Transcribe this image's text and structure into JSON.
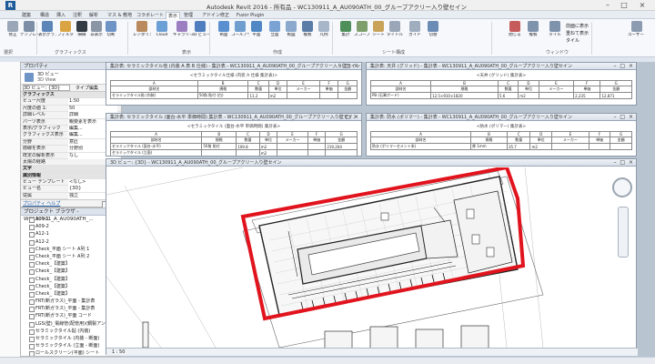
{
  "app": {
    "title": "Autodesk Revit 2016 -  所有品 -  WC130911_A_AU090ATH_00_グループアクリー入り壁セイン",
    "icon_letter": "R"
  },
  "window_controls": {
    "minimize": "–",
    "maximize": "□",
    "close": "×"
  },
  "tabs": [
    {
      "label": "建築",
      "active": false
    },
    {
      "label": "構造",
      "active": false
    },
    {
      "label": "挿入",
      "active": false
    },
    {
      "label": "注釈",
      "active": false
    },
    {
      "label": "解析",
      "active": false
    },
    {
      "label": "マス & 敷地",
      "active": false
    },
    {
      "label": "コラボレート",
      "active": false
    },
    {
      "label": "表示",
      "active": true
    },
    {
      "label": "管理",
      "active": false
    },
    {
      "label": "アドイン",
      "active": false
    },
    {
      "label": "修正",
      "active": false
    },
    {
      "label": "Fuzor Plugin",
      "active": false
    }
  ],
  "ribbon": {
    "buttons": [
      {
        "label": "修正",
        "color": "#9aa7b8"
      },
      {
        "label": "テンプレート",
        "color": "#7c8fa6"
      },
      {
        "label": "表示グラフィックス",
        "color": "#5d86b8"
      },
      {
        "label": "フィルタ",
        "color": "#d9a441"
      },
      {
        "label": "細線",
        "color": "#333b44"
      },
      {
        "label": "非表示",
        "color": "#8a96a5"
      },
      {
        "label": "切断",
        "color": "#6f94c6"
      },
      {
        "label": "レンダリング",
        "color": "#b88a5d"
      },
      {
        "label": "Cloud",
        "color": "#6aa0d6"
      },
      {
        "label": "ギャラリー",
        "color": "#9c7fc1"
      },
      {
        "label": "3D ビュー",
        "color": "#4f7fbf"
      },
      {
        "label": "断面",
        "color": "#5a8fd0"
      },
      {
        "label": "コールアウト",
        "color": "#6f9ecf"
      },
      {
        "label": "平面",
        "color": "#4f88c4"
      },
      {
        "label": "立面",
        "color": "#7aa3d4"
      },
      {
        "label": "製図",
        "color": "#8aa9cc"
      },
      {
        "label": "複製",
        "color": "#5b7ea8"
      },
      {
        "label": "凡例",
        "color": "#a7b6c9"
      },
      {
        "label": "集計",
        "color": "#4f8f5a"
      },
      {
        "label": "スコープ",
        "color": "#7e9f6b"
      },
      {
        "label": "シート",
        "color": "#c9a35a"
      },
      {
        "label": "タイトル",
        "color": "#9aa7b8"
      },
      {
        "label": "ガイド",
        "color": "#a0adbf"
      },
      {
        "label": "切替",
        "color": "#6b8cb5"
      },
      {
        "label": "閉じる",
        "color": "#c65b5b"
      },
      {
        "label": "複製",
        "color": "#7f93ad"
      },
      {
        "label": "タイル",
        "color": "#7f93ad"
      },
      {
        "label": "ユーザー インターフェース",
        "color": "#8c9bb0"
      }
    ],
    "groups": [
      {
        "label": "選択"
      },
      {
        "label": "グラフィックス"
      },
      {
        "label": "表示"
      },
      {
        "label": "作成"
      },
      {
        "label": "シート構成"
      },
      {
        "label": "ウィンドウ"
      }
    ],
    "window_options": [
      "前面に表示",
      "重ねて表示",
      "タイル"
    ]
  },
  "properties": {
    "title": "プロパティ",
    "type_name": "3D ビュー",
    "type_sub": "3D View",
    "selector": "3D ビュー: {3D}",
    "edit_type": "タイプ編集",
    "rows": [
      {
        "k": "グラフィックス",
        "v": "",
        "cat": true
      },
      {
        "k": "ビュー尺度",
        "v": "1:50",
        "cat": false
      },
      {
        "k": "尺度の値 1:",
        "v": "50",
        "cat": false
      },
      {
        "k": "詳細レベル",
        "v": "詳細",
        "cat": false
      },
      {
        "k": "パーツ表示",
        "v": "親要素を表示",
        "cat": false
      },
      {
        "k": "表示/グラフィック",
        "v": "編集...",
        "cat": false
      },
      {
        "k": "グラフィックス表示",
        "v": "編集...",
        "cat": false
      },
      {
        "k": "分野",
        "v": "意匠",
        "cat": false
      },
      {
        "k": "隠線を表示",
        "v": "分野別",
        "cat": false
      },
      {
        "k": "既定の解析表示",
        "v": "なし",
        "cat": false
      },
      {
        "k": "太陽の経路",
        "v": "",
        "cat": false
      },
      {
        "k": "文字",
        "v": "",
        "cat": true
      },
      {
        "k": "識別情報",
        "v": "",
        "cat": true
      },
      {
        "k": "ビュー テンプレート",
        "v": "<なし>",
        "cat": false
      },
      {
        "k": "ビュー名",
        "v": "{3D}",
        "cat": false
      },
      {
        "k": "従属",
        "v": "独立",
        "cat": false
      }
    ],
    "help": "プロパティ ヘルプ",
    "apply": "適用"
  },
  "browser": {
    "title": "プロジェクト ブラウザ - WC130911_A_AU090ATH_...",
    "items": [
      "A09-1",
      "A09-2",
      "A12-1",
      "A12-2",
      "Check_平面 シート   A列 1",
      "Check_平面 シート   A列 2",
      "Check_【建築】",
      "Check_【建築】",
      "Check_【建築】",
      "Check_【建築】",
      "Check_【建築】",
      "FRT(断ガラス)_平面 - 集計表",
      "FRT(断ガラス)_平面 - 集計表",
      "FRT(断ガラス)_平面   コード",
      "LGS(壁)_電線管(配管用)(鋼製アンカ)",
      "セラミックタイル貼 (内装)",
      "セラミックタイル (内装 - 断面)",
      "セラミックタイル (立面 - 断面)",
      "ロールスクリーン(平面)   シート",
      "集計表 - 平面   シート",
      "集計表 - 断面 (床)"
    ]
  },
  "schedules": [
    {
      "title": "集計表: セラミックタイル他 (内装 A 表 B 仕様) - 集計表 - WC130911_A_AU090ATH_00_グループアクリー入り壁セイン",
      "heading": "<セラミックタイル仕様 (内装 A 仕様 集計表)>",
      "head": [
        "A",
        "B",
        "C",
        "D",
        "E",
        "F",
        "G"
      ],
      "sub": [
        "部材名",
        "規格",
        "数量",
        "単位",
        "メーカー",
        "単価",
        "金額"
      ],
      "rows": [
        [
          "セラミックタイル貼 (内装)",
          "50角 貼付 (白)",
          "11.2",
          "m2",
          "",
          "",
          ""
        ]
      ]
    },
    {
      "title": "集計表: 天井 (グリッド) - 集計表 - WC130911_A_AU090ATH_00_グループアクリー入り壁セイン",
      "heading": "<天井 (グリッド) 集計表>",
      "head": [
        "A",
        "B",
        "C",
        "D",
        "E",
        "F",
        "G"
      ],
      "sub": [
        "部材名",
        "規格",
        "数量",
        "単位",
        "メーカー",
        "単価",
        "金額"
      ],
      "rows": [
        [
          "PB (石膏ボード)",
          "12.5×910×1820",
          "5.6",
          "m2",
          "",
          "2,235",
          "12,871"
        ]
      ]
    },
    {
      "title": "集計表: セラミックタイル (面台-水平 単価時間) 集計表 - WC130911_A_AU090ATH_00_グループアクリー入り壁セイン",
      "heading": "<セラミックタイル (面台-水平 単価時間) 集計表>",
      "head": [
        "A",
        "B",
        "C",
        "D",
        "E",
        "F",
        "G"
      ],
      "sub": [
        "部材名",
        "規格",
        "数量",
        "単位",
        "メーカー",
        "単価",
        "金額"
      ],
      "rows": [
        [
          "セラミックタイル (面台-水平)",
          "50角 貼付",
          "109.8",
          "m2",
          "",
          "",
          "219,204"
        ],
        [
          "セラミックタイル (立面)",
          "",
          "",
          "m2",
          "",
          "",
          ""
        ]
      ]
    },
    {
      "title": "集計表: 防水 (ポリマー) - 集計表 - WC130911_A_AU090ATH_00_グループアクリー入り壁セイン",
      "heading": "<防水 (ポリマー) 集計表>",
      "head": [
        "A",
        "B",
        "C",
        "D",
        "E",
        "F",
        "G"
      ],
      "sub": [
        "部材名",
        "規格",
        "数量",
        "単位",
        "メーカー",
        "単価",
        "金額"
      ],
      "rows": [
        [
          "防水 (ポリマーセメント系)",
          "厚 1mm",
          "35.7",
          "m2",
          "",
          "",
          ""
        ]
      ]
    }
  ],
  "main_view": {
    "title": "3D ビュー: {3D} - WC130911_A_AU090ATH_00_グループアクリー入り壁セイン",
    "scale": "1 : 50",
    "highlight_color": "#e1141e"
  }
}
